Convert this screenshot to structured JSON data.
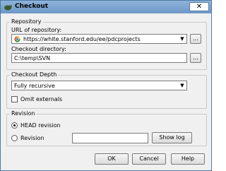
{
  "window": {
    "title": "Checkout",
    "close_glyph": "✕"
  },
  "repository": {
    "group_label": "Repository",
    "url_label": "URL of repository:",
    "url_value": "https://white.stanford.edu/ee/pdcprojects",
    "dir_label": "Checkout directory:",
    "dir_value": "C:\\temp\\SVN",
    "browse_label": "..."
  },
  "depth": {
    "group_label": "Checkout Depth",
    "selected": "Fully recursive",
    "omit_externals_label": "Omit externals",
    "omit_externals_checked": false
  },
  "revision": {
    "group_label": "Revision",
    "head_label": "HEAD revision",
    "revision_label": "Revision",
    "head_selected": true,
    "revision_value": "",
    "show_log_label": "Show log"
  },
  "buttons": {
    "ok": "OK",
    "cancel": "Cancel",
    "help": "Help"
  },
  "icons": {
    "app": "tortoise-icon",
    "url": "globe-icon"
  }
}
